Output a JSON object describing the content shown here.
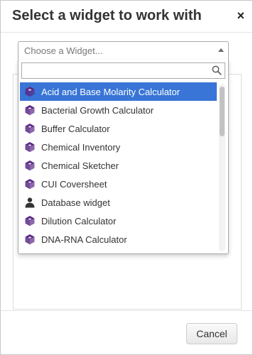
{
  "dialog": {
    "title": "Select a widget to work with",
    "close_label": "×",
    "cancel_label": "Cancel"
  },
  "select": {
    "placeholder": "Choose a Widget...",
    "search_value": ""
  },
  "widgets": [
    {
      "label": "Acid and Base Molarity Calculator",
      "icon": "cube-icon",
      "highlighted": true
    },
    {
      "label": "Bacterial Growth Calculator",
      "icon": "cube-icon"
    },
    {
      "label": "Buffer Calculator",
      "icon": "cube-icon"
    },
    {
      "label": "Chemical Inventory",
      "icon": "cube-icon"
    },
    {
      "label": "Chemical Sketcher",
      "icon": "cube-icon"
    },
    {
      "label": "CUI Coversheet",
      "icon": "cube-icon"
    },
    {
      "label": "Database widget",
      "icon": "person-icon"
    },
    {
      "label": "Dilution Calculator",
      "icon": "cube-icon"
    },
    {
      "label": "DNA-RNA Calculator",
      "icon": "cube-icon"
    }
  ],
  "colors": {
    "highlight": "#3875d7",
    "cube_icon": "#5b2a86"
  }
}
